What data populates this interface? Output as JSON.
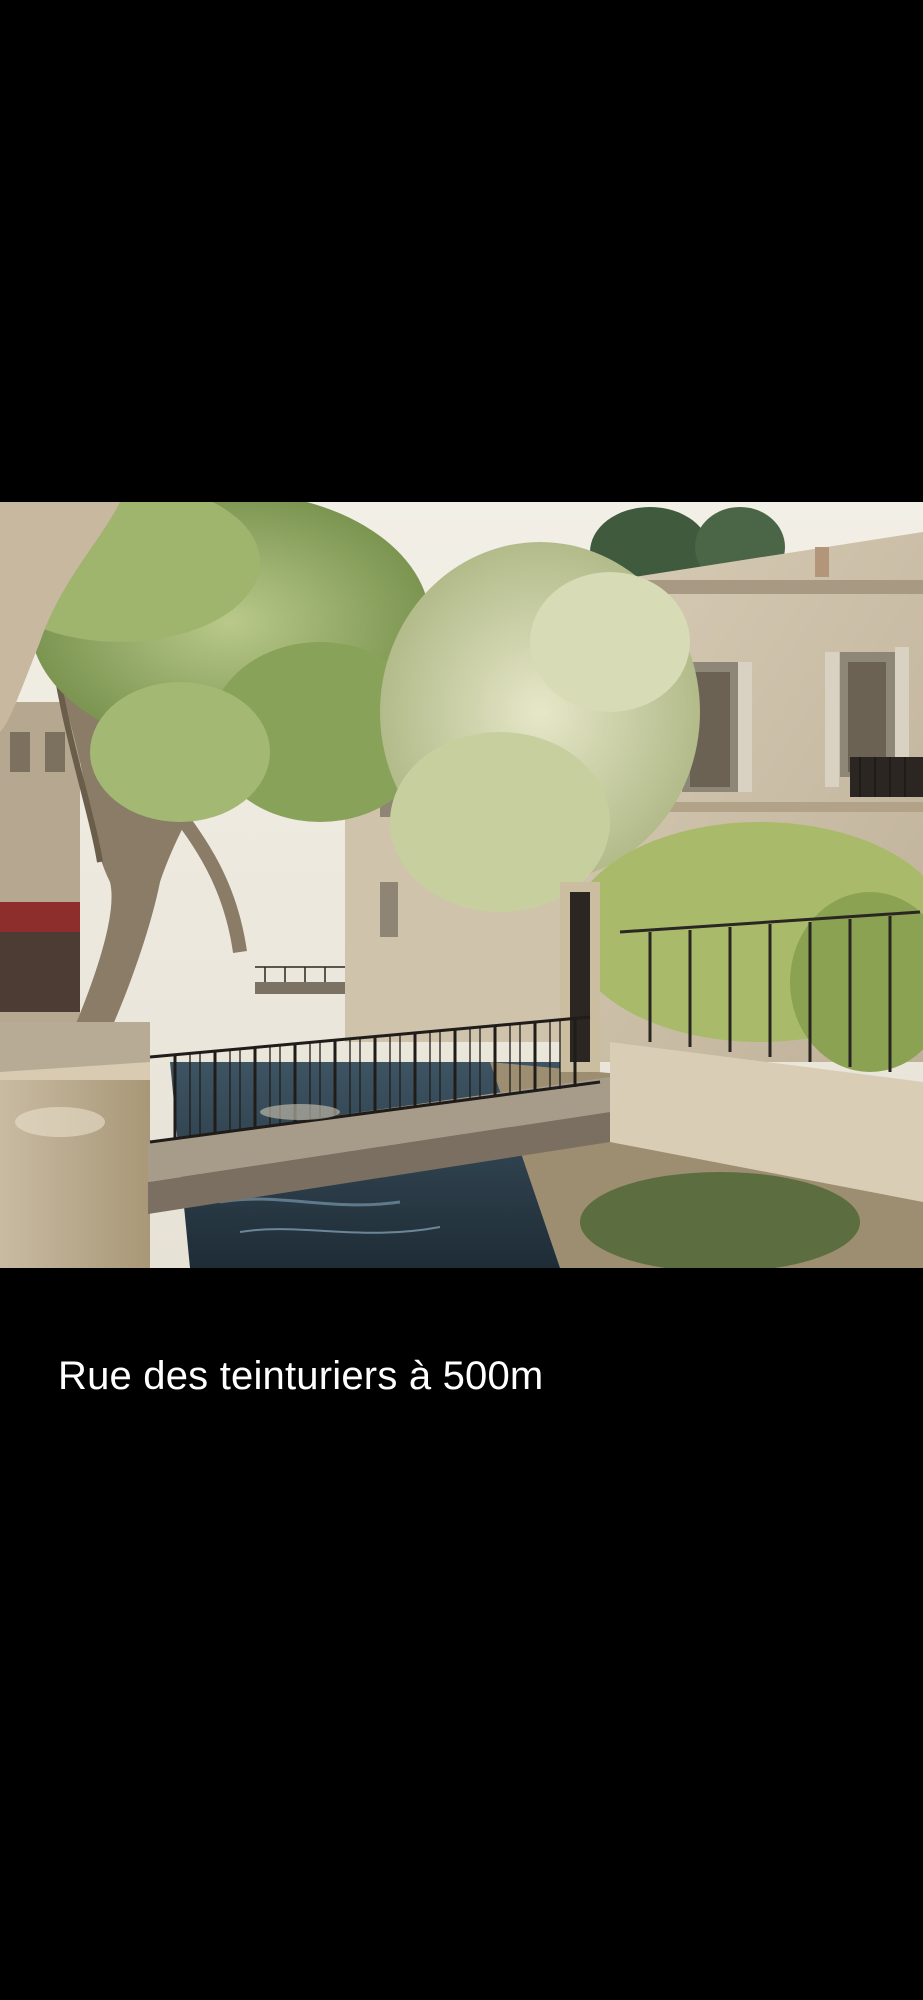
{
  "viewer": {
    "photo": {
      "alt": "Rue des teinturiers à 500m"
    },
    "caption": "Rue des teinturiers à 500m"
  }
}
